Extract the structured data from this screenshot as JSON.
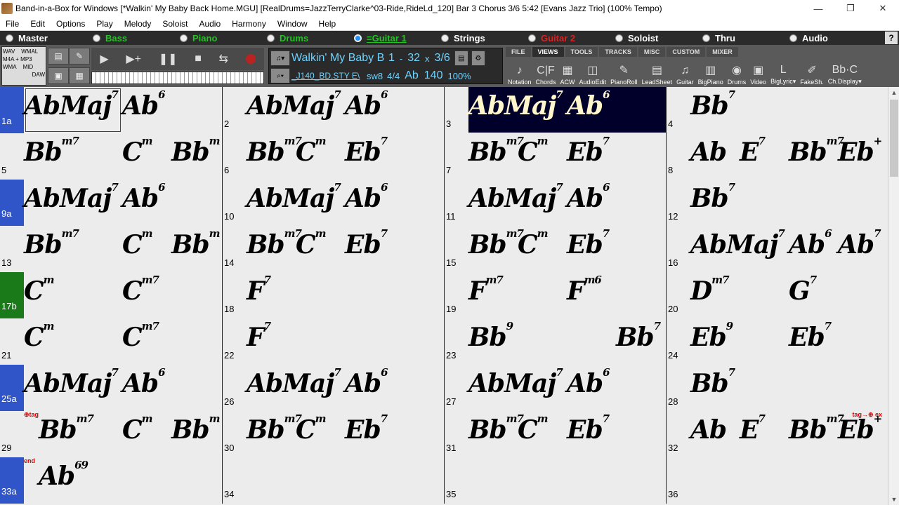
{
  "window": {
    "title": "Band-in-a-Box for Windows  [*Walkin' My Baby Back Home.MGU] [RealDrums=JazzTerryClarke^03-Ride,RideLd_120] Bar 3 Chorus 3/6   5:42  [Evans Jazz Trio] (100% Tempo)",
    "minimize": "—",
    "restore": "❐",
    "close": "✕"
  },
  "menu": [
    "File",
    "Edit",
    "Options",
    "Play",
    "Melody",
    "Soloist",
    "Audio",
    "Harmony",
    "Window",
    "Help"
  ],
  "tracks": [
    {
      "label": "Master",
      "color": "#ffffff",
      "selected": false
    },
    {
      "label": "Bass",
      "color": "#22c322",
      "selected": false
    },
    {
      "label": "Piano",
      "color": "#22c322",
      "selected": false
    },
    {
      "label": "Drums",
      "color": "#22c322",
      "selected": false
    },
    {
      "label": "=Guitar 1",
      "color": "#22c322",
      "selected": true
    },
    {
      "label": "Strings",
      "color": "#ffffff",
      "selected": false
    },
    {
      "label": "Guitar 2",
      "color": "#e02020",
      "selected": false
    },
    {
      "label": "Soloist",
      "color": "#ffffff",
      "selected": false
    },
    {
      "label": "Thru",
      "color": "#ffffff",
      "selected": false
    },
    {
      "label": "Audio",
      "color": "#ffffff",
      "selected": false
    }
  ],
  "help_label": "?",
  "toolbar": {
    "formats": [
      "WAV",
      "WMAL",
      "M4A",
      "+",
      "MP3",
      "WMA",
      "MID",
      "DAW"
    ],
    "transport": {
      "play": "▶",
      "play_from": "▶+",
      "pause": "❚❚",
      "stop": "■",
      "loop": "⇆"
    },
    "song_title": "Walkin' My Baby B",
    "start_bar": "1",
    "dash": "-",
    "end_bar": "32",
    "times": "x",
    "chorus": "3/6",
    "style_file": "_J140_BD.STY E\\",
    "feel": "sw8",
    "time_sig": "4/4",
    "key": "Ab",
    "tempo": "140",
    "tempo_pct": "100%"
  },
  "view_tabs": [
    {
      "label": "FILE",
      "active": false
    },
    {
      "label": "VIEWS",
      "active": true
    },
    {
      "label": "TOOLS",
      "active": false
    },
    {
      "label": "TRACKS",
      "active": false
    },
    {
      "label": "MISC",
      "active": false
    },
    {
      "label": "CUSTOM",
      "active": false
    },
    {
      "label": "MIXER",
      "active": false
    }
  ],
  "view_buttons": [
    {
      "label": "Notation",
      "glyph": "♪",
      "icon": "notation-icon"
    },
    {
      "label": "Chords",
      "glyph": "C|F",
      "icon": "chords-icon"
    },
    {
      "label": "ACW",
      "glyph": "▦",
      "icon": "acw-icon"
    },
    {
      "label": "AudioEdit",
      "glyph": "◫",
      "icon": "audioedit-icon"
    },
    {
      "label": "PianoRoll",
      "glyph": "✎",
      "icon": "pianoroll-icon"
    },
    {
      "label": "LeadSheet",
      "glyph": "▤",
      "icon": "leadsheet-icon"
    },
    {
      "label": "Guitar",
      "glyph": "♫",
      "icon": "guitar-icon"
    },
    {
      "label": "BigPiano",
      "glyph": "▥",
      "icon": "bigpiano-icon"
    },
    {
      "label": "Drums",
      "glyph": "◉",
      "icon": "drums-icon"
    },
    {
      "label": "Video",
      "glyph": "▣",
      "icon": "video-icon"
    },
    {
      "label": "BigLyric▾",
      "glyph": "L",
      "icon": "biglyric-icon"
    },
    {
      "label": "FakeSh.",
      "glyph": "✐",
      "icon": "fakesheet-icon"
    },
    {
      "label": "Ch.Display▾",
      "glyph": "Bb·C",
      "icon": "chord-display-icon"
    }
  ],
  "markers": {
    "tag_start": "⊕tag",
    "tag_end": "tag→⊕ ex",
    "end": "end"
  },
  "rows": [
    {
      "bars": [
        {
          "num": "1a",
          "part": "blue",
          "chords": [
            {
              "root": "AbMaj",
              "ext": "7",
              "pos": 0
            },
            {
              "root": "Ab",
              "ext": "6",
              "pos": 2
            }
          ]
        },
        {
          "num": "2",
          "chords": [
            {
              "root": "AbMaj",
              "ext": "7",
              "pos": 0
            },
            {
              "root": "Ab",
              "ext": "6",
              "pos": 2
            }
          ]
        },
        {
          "num": "3",
          "current": true,
          "chords": [
            {
              "root": "AbMaj",
              "ext": "7",
              "pos": 0
            },
            {
              "root": "Ab",
              "ext": "6",
              "pos": 2
            }
          ]
        },
        {
          "num": "4",
          "chords": [
            {
              "root": "Bb",
              "ext": "7",
              "pos": 0
            }
          ]
        }
      ]
    },
    {
      "bars": [
        {
          "num": "5",
          "chords": [
            {
              "root": "Bb",
              "ext": "m7",
              "pos": 0
            },
            {
              "root": "C",
              "ext": "m",
              "pos": 2
            },
            {
              "root": "Bb",
              "ext": "m",
              "pos": 3
            }
          ]
        },
        {
          "num": "6",
          "chords": [
            {
              "root": "Bb",
              "ext": "m7",
              "pos": 0
            },
            {
              "root": "C",
              "ext": "m",
              "pos": 1
            },
            {
              "root": "Eb",
              "ext": "7",
              "pos": 2
            }
          ]
        },
        {
          "num": "7",
          "chords": [
            {
              "root": "Bb",
              "ext": "m7",
              "pos": 0
            },
            {
              "root": "C",
              "ext": "m",
              "pos": 1
            },
            {
              "root": "Eb",
              "ext": "7",
              "pos": 2
            }
          ]
        },
        {
          "num": "8",
          "chords": [
            {
              "root": "Ab",
              "ext": "",
              "pos": 0
            },
            {
              "root": "E",
              "ext": "7",
              "pos": 1
            },
            {
              "root": "Bb",
              "ext": "m7",
              "pos": 2
            },
            {
              "root": "Eb",
              "ext": "+",
              "pos": 3
            }
          ]
        }
      ]
    },
    {
      "bars": [
        {
          "num": "9a",
          "part": "blue",
          "chords": [
            {
              "root": "AbMaj",
              "ext": "7",
              "pos": 0
            },
            {
              "root": "Ab",
              "ext": "6",
              "pos": 2
            }
          ]
        },
        {
          "num": "10",
          "chords": [
            {
              "root": "AbMaj",
              "ext": "7",
              "pos": 0
            },
            {
              "root": "Ab",
              "ext": "6",
              "pos": 2
            }
          ]
        },
        {
          "num": "11",
          "chords": [
            {
              "root": "AbMaj",
              "ext": "7",
              "pos": 0
            },
            {
              "root": "Ab",
              "ext": "6",
              "pos": 2
            }
          ]
        },
        {
          "num": "12",
          "chords": [
            {
              "root": "Bb",
              "ext": "7",
              "pos": 0
            }
          ]
        }
      ]
    },
    {
      "bars": [
        {
          "num": "13",
          "chords": [
            {
              "root": "Bb",
              "ext": "m7",
              "pos": 0
            },
            {
              "root": "C",
              "ext": "m",
              "pos": 2
            },
            {
              "root": "Bb",
              "ext": "m",
              "pos": 3
            }
          ]
        },
        {
          "num": "14",
          "chords": [
            {
              "root": "Bb",
              "ext": "m7",
              "pos": 0
            },
            {
              "root": "C",
              "ext": "m",
              "pos": 1
            },
            {
              "root": "Eb",
              "ext": "7",
              "pos": 2
            }
          ]
        },
        {
          "num": "15",
          "chords": [
            {
              "root": "Bb",
              "ext": "m7",
              "pos": 0
            },
            {
              "root": "C",
              "ext": "m",
              "pos": 1
            },
            {
              "root": "Eb",
              "ext": "7",
              "pos": 2
            }
          ]
        },
        {
          "num": "16",
          "chords": [
            {
              "root": "AbMaj",
              "ext": "7",
              "pos": 0
            },
            {
              "root": "Ab",
              "ext": "6",
              "pos": 2
            },
            {
              "root": "Ab",
              "ext": "7",
              "pos": 3
            }
          ]
        }
      ]
    },
    {
      "bars": [
        {
          "num": "17b",
          "part": "green",
          "chords": [
            {
              "root": "C",
              "ext": "m",
              "pos": 0
            },
            {
              "root": "C",
              "ext": "m7",
              "pos": 2
            }
          ]
        },
        {
          "num": "18",
          "chords": [
            {
              "root": "F",
              "ext": "7",
              "pos": 0
            }
          ]
        },
        {
          "num": "19",
          "chords": [
            {
              "root": "F",
              "ext": "m7",
              "pos": 0
            },
            {
              "root": "F",
              "ext": "m6",
              "pos": 2
            }
          ]
        },
        {
          "num": "20",
          "chords": [
            {
              "root": "D",
              "ext": "m7",
              "pos": 0
            },
            {
              "root": "G",
              "ext": "7",
              "pos": 2
            }
          ]
        }
      ]
    },
    {
      "bars": [
        {
          "num": "21",
          "chords": [
            {
              "root": "C",
              "ext": "m",
              "pos": 0
            },
            {
              "root": "C",
              "ext": "m7",
              "pos": 2
            }
          ]
        },
        {
          "num": "22",
          "chords": [
            {
              "root": "F",
              "ext": "7",
              "pos": 0
            }
          ]
        },
        {
          "num": "23",
          "chords": [
            {
              "root": "Bb",
              "ext": "9",
              "pos": 0
            },
            {
              "root": "Bb",
              "ext": "7",
              "pos": 3
            }
          ]
        },
        {
          "num": "24",
          "chords": [
            {
              "root": "Eb",
              "ext": "9",
              "pos": 0
            },
            {
              "root": "Eb",
              "ext": "7",
              "pos": 2
            }
          ]
        }
      ]
    },
    {
      "bars": [
        {
          "num": "25a",
          "part": "blue",
          "chords": [
            {
              "root": "AbMaj",
              "ext": "7",
              "pos": 0
            },
            {
              "root": "Ab",
              "ext": "6",
              "pos": 2
            }
          ]
        },
        {
          "num": "26",
          "chords": [
            {
              "root": "AbMaj",
              "ext": "7",
              "pos": 0
            },
            {
              "root": "Ab",
              "ext": "6",
              "pos": 2
            }
          ]
        },
        {
          "num": "27",
          "chords": [
            {
              "root": "AbMaj",
              "ext": "7",
              "pos": 0
            },
            {
              "root": "Ab",
              "ext": "6",
              "pos": 2
            }
          ]
        },
        {
          "num": "28",
          "chords": [
            {
              "root": "Bb",
              "ext": "7",
              "pos": 0
            }
          ]
        }
      ]
    },
    {
      "bars": [
        {
          "num": "29",
          "marker": "tag_start",
          "chords": [
            {
              "root": "Bb",
              "ext": "m7",
              "pos": 0.3
            },
            {
              "root": "C",
              "ext": "m",
              "pos": 2
            },
            {
              "root": "Bb",
              "ext": "m",
              "pos": 3
            }
          ]
        },
        {
          "num": "30",
          "chords": [
            {
              "root": "Bb",
              "ext": "m7",
              "pos": 0
            },
            {
              "root": "C",
              "ext": "m",
              "pos": 1
            },
            {
              "root": "Eb",
              "ext": "7",
              "pos": 2
            }
          ]
        },
        {
          "num": "31",
          "chords": [
            {
              "root": "Bb",
              "ext": "m7",
              "pos": 0
            },
            {
              "root": "C",
              "ext": "m",
              "pos": 1
            },
            {
              "root": "Eb",
              "ext": "7",
              "pos": 2
            }
          ]
        },
        {
          "num": "32",
          "marker": "tag_end",
          "chords": [
            {
              "root": "Ab",
              "ext": "",
              "pos": 0
            },
            {
              "root": "E",
              "ext": "7",
              "pos": 1
            },
            {
              "root": "Bb",
              "ext": "m7",
              "pos": 2
            },
            {
              "root": "Eb",
              "ext": "+",
              "pos": 3
            }
          ]
        }
      ]
    },
    {
      "bars": [
        {
          "num": "33a",
          "part": "blue",
          "marker": "end",
          "chords": [
            {
              "root": "Ab",
              "ext": "69",
              "pos": 0.3
            }
          ]
        },
        {
          "num": "34",
          "chords": []
        },
        {
          "num": "35",
          "chords": []
        },
        {
          "num": "36",
          "chords": []
        }
      ]
    }
  ]
}
